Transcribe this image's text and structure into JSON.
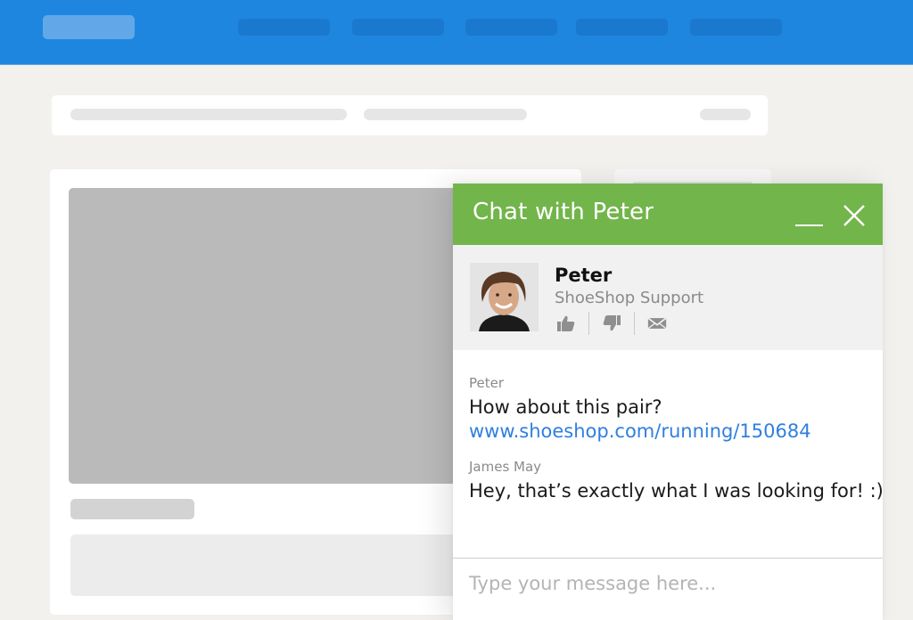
{
  "topbar": {
    "colors": {
      "bar": "#1e86df",
      "logo": "#62a8e9",
      "nav": "#1a79cf"
    },
    "nav_items": 5
  },
  "page": {
    "background": "#f2f1ee"
  },
  "chat": {
    "title": "Chat with Peter",
    "header_color": "#72b54b",
    "icons": {
      "minimize": "minimize-icon",
      "close": "close-icon"
    },
    "agent": {
      "name": "Peter",
      "role": "ShoeShop Support",
      "avatar": "agent-photo",
      "actions": [
        {
          "name": "thumbs-up-icon",
          "label": "Rate positive"
        },
        {
          "name": "thumbs-down-icon",
          "label": "Rate negative"
        },
        {
          "name": "envelope-icon",
          "label": "Email transcript"
        }
      ]
    },
    "messages": [
      {
        "author": "Peter",
        "text": "How about this pair?",
        "link": "www.shoeshop.com/running/150684"
      },
      {
        "author": "James May",
        "text": "Hey, that’s exactly what I was looking for! :)"
      }
    ],
    "link_color": "#2f7fe0",
    "composer": {
      "placeholder": "Type your message here...",
      "value": ""
    }
  }
}
